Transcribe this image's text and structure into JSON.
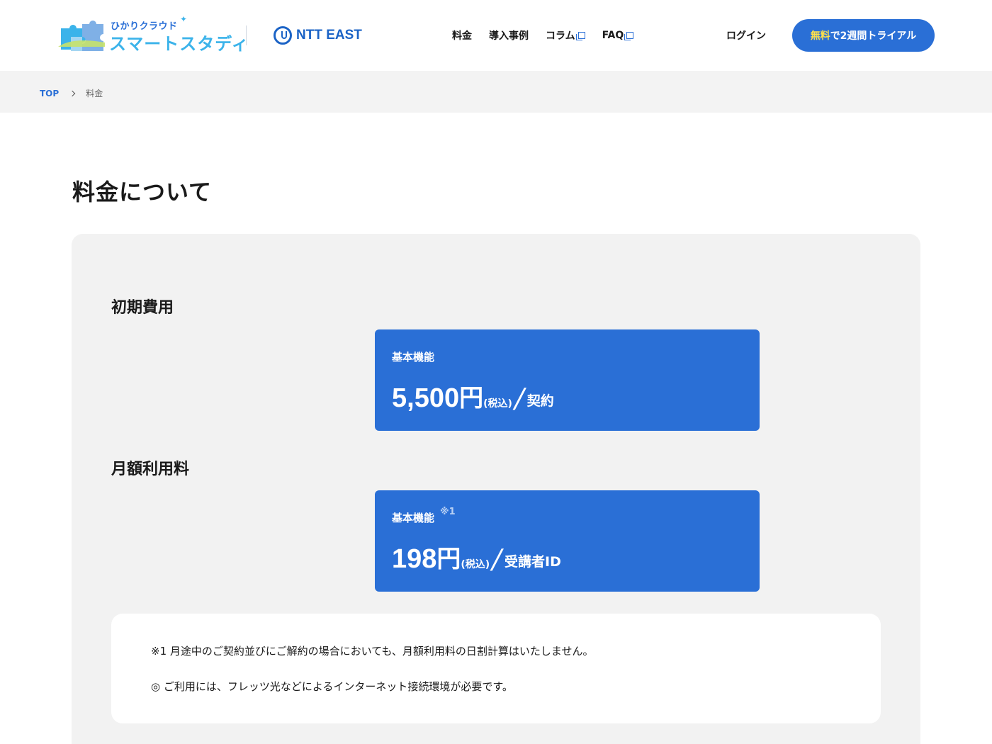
{
  "brand": {
    "logo_small": "ひかりクラウド",
    "logo_big": "スマートスタディ",
    "partner": "NTT EAST"
  },
  "nav": {
    "items": [
      {
        "label": "料金",
        "external": false
      },
      {
        "label": "導入事例",
        "external": false
      },
      {
        "label": "コラム",
        "external": true
      },
      {
        "label": "FAQ",
        "external": true
      }
    ],
    "login": "ログイン",
    "cta_highlight": "無料",
    "cta_rest": "で2週間トライアル"
  },
  "breadcrumb": {
    "top": "TOP",
    "current": "料金"
  },
  "page": {
    "title": "料金について"
  },
  "initial_fee": {
    "heading": "初期費用",
    "card": {
      "label": "基本機能",
      "note_mark": "",
      "amount": "5,500",
      "currency": "円",
      "tax": "(税込)",
      "slash": "/",
      "unit": "契約"
    }
  },
  "monthly_fee": {
    "heading": "月額利用料",
    "card": {
      "label": "基本機能",
      "note_mark": "※1",
      "amount": "198",
      "currency": "円",
      "tax": "(税込)",
      "slash": "/",
      "unit": "受講者ID"
    }
  },
  "notes": [
    "※1  月途中のご契約並びにご解約の場合においても、月額利用料の日割計算はいたしません。",
    "◎ ご利用には、フレッツ光などによるインターネット接続環境が必要です。"
  ],
  "colors": {
    "primary": "#2a6fd6",
    "highlight": "#ffe14a",
    "panel_bg": "#f2f2f2",
    "breadcrumb_bg": "#f3f3f3"
  }
}
